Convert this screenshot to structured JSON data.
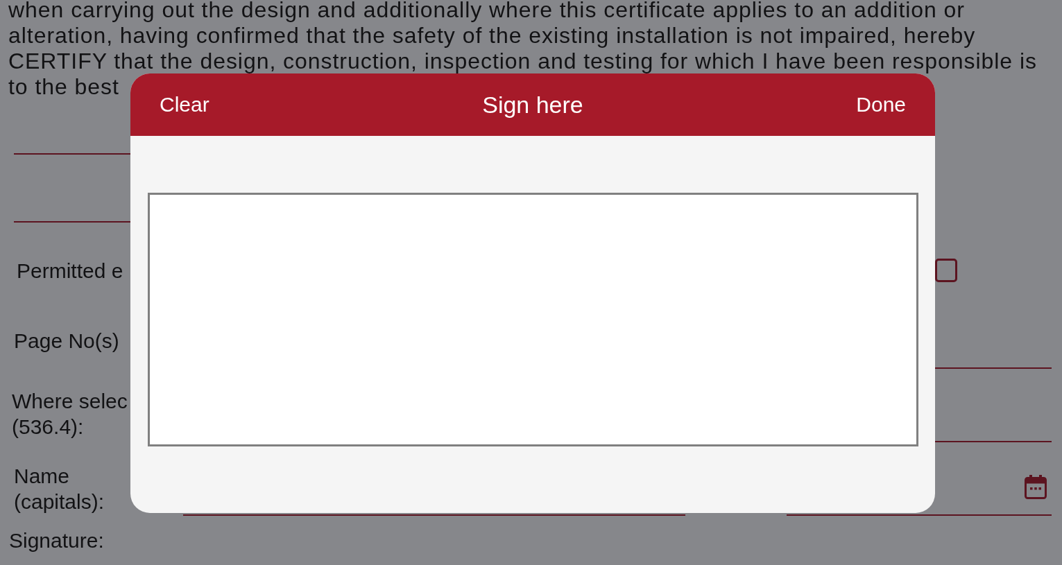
{
  "form": {
    "paragraph": [
      "when carrying out the design and additionally where this certificate applies to an addition or",
      "alteration, having confirmed that the safety of the existing installation is not impaired, hereby",
      "CERTIFY that the design, construction, inspection and testing for which I have been responsible is",
      "to the best"
    ],
    "rows": [
      {
        "kind": "blank"
      },
      {
        "kind": "blank"
      },
      {
        "kind": "checkbox",
        "label": "Permitted e",
        "checked": false
      },
      {
        "kind": "text",
        "label": "Page No(s)"
      },
      {
        "kind": "text",
        "label": "Where selec (536.4):"
      },
      {
        "kind": "name_date",
        "label": "Name (capitals):"
      },
      {
        "kind": "signature",
        "label": "Signature:"
      }
    ]
  },
  "dialog": {
    "title": "Sign here",
    "clear_button": "Clear",
    "done_button": "Done"
  }
}
